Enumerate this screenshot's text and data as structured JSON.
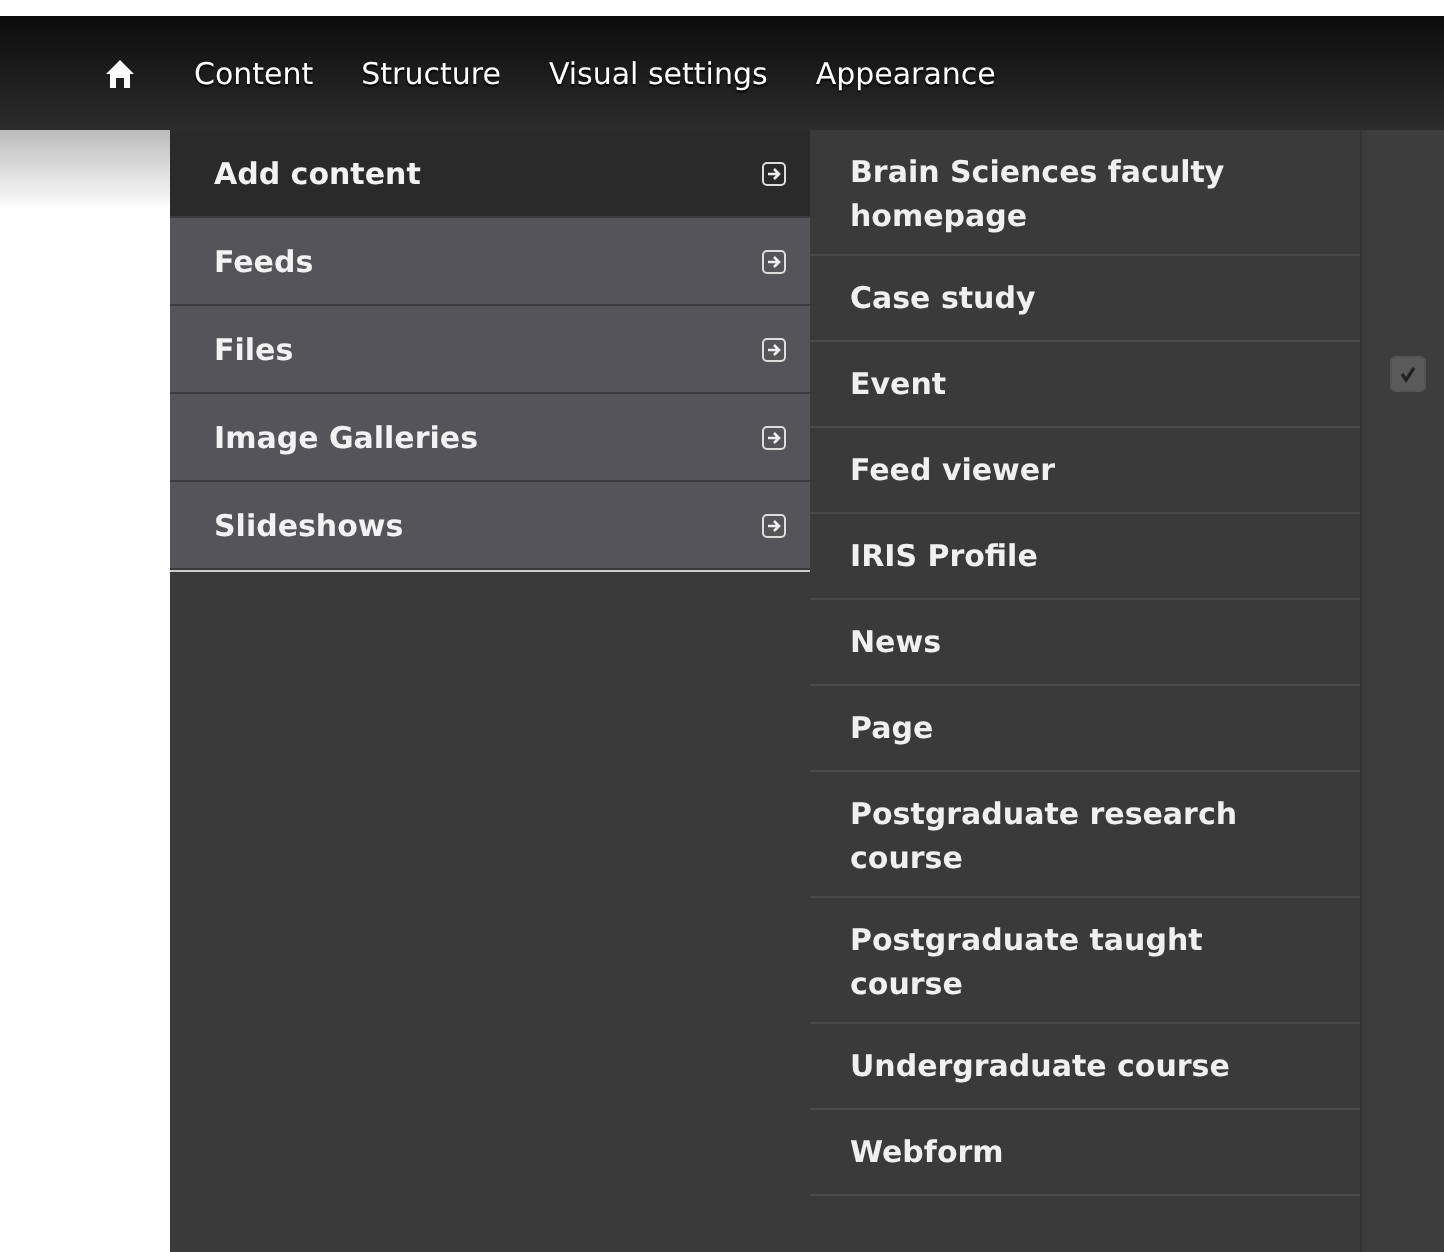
{
  "toolbar": {
    "items": [
      "Content",
      "Structure",
      "Visual settings",
      "Appearance"
    ]
  },
  "menu": {
    "items": [
      {
        "label": "Add content",
        "selected": true,
        "has_submenu": true
      },
      {
        "label": "Feeds",
        "selected": false,
        "has_submenu": true
      },
      {
        "label": "Files",
        "selected": false,
        "has_submenu": true
      },
      {
        "label": "Image Galleries",
        "selected": false,
        "has_submenu": true
      },
      {
        "label": "Slideshows",
        "selected": false,
        "has_submenu": true
      }
    ]
  },
  "submenu": {
    "items": [
      "Brain Sciences faculty homepage",
      "Case study",
      "Event",
      "Feed viewer",
      "IRIS Profile",
      "News",
      "Page",
      "Postgraduate research course",
      "Postgraduate taught course",
      "Undergraduate course",
      "Webform"
    ]
  },
  "background_page": {
    "items": [
      {
        "kind": "checkbox",
        "checked": true
      }
    ]
  }
}
